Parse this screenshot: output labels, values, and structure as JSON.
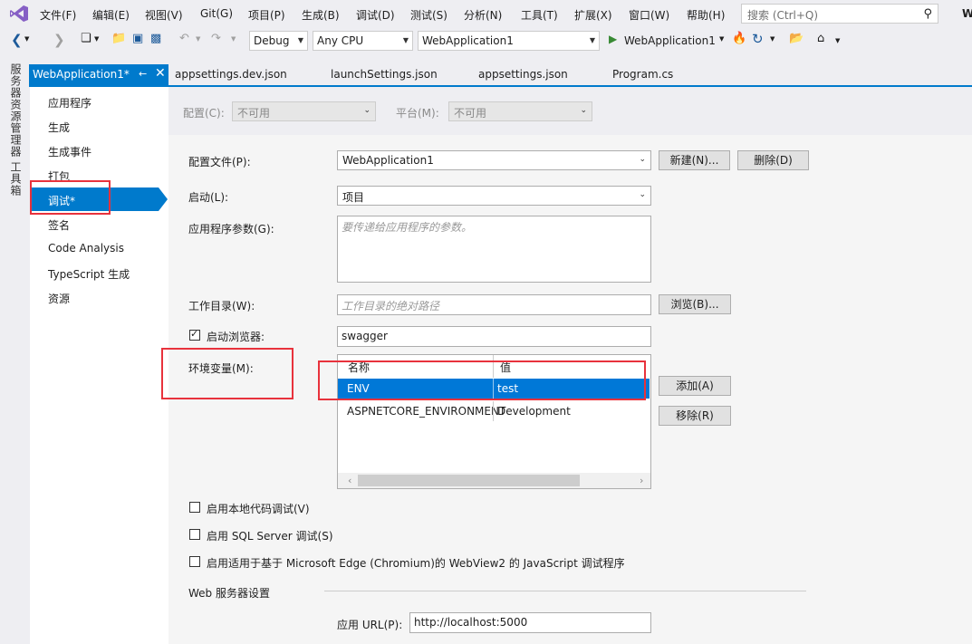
{
  "menu": [
    "文件(F)",
    "编辑(E)",
    "视图(V)",
    "Git(G)",
    "项目(P)",
    "生成(B)",
    "调试(D)",
    "测试(S)",
    "分析(N)",
    "工具(T)",
    "扩展(X)",
    "窗口(W)",
    "帮助(H)"
  ],
  "search": {
    "placeholder": "搜索 (Ctrl+Q)"
  },
  "title_fragment": "W",
  "toolbar": {
    "config": "Debug",
    "platform": "Any CPU",
    "project": "WebApplication1",
    "run_label": "WebApplication1"
  },
  "left_strip": {
    "server_explorer": "服务器资源管理器",
    "toolbox": "工具箱"
  },
  "tabs": {
    "active": "WebApplication1*",
    "others": [
      "appsettings.dev.json",
      "launchSettings.json",
      "appsettings.json",
      "Program.cs"
    ]
  },
  "nav": [
    "应用程序",
    "生成",
    "生成事件",
    "打包",
    "调试*",
    "签名",
    "Code Analysis",
    "TypeScript 生成",
    "资源"
  ],
  "top_row": {
    "config_label": "配置(C):",
    "config_value": "不可用",
    "platform_label": "平台(M):",
    "platform_value": "不可用"
  },
  "form": {
    "profile_label": "配置文件(P):",
    "profile_value": "WebApplication1",
    "new_button": "新建(N)...",
    "delete_button": "删除(D)",
    "launch_label": "启动(L):",
    "launch_value": "项目",
    "args_label": "应用程序参数(G):",
    "args_placeholder": "要传递给应用程序的参数。",
    "workdir_label": "工作目录(W):",
    "workdir_placeholder": "工作目录的绝对路径",
    "browse_button": "浏览(B)...",
    "launch_browser_label": "启动浏览器:",
    "launch_browser_value": "swagger",
    "env_label": "环境变量(M):",
    "env_headers": {
      "name": "名称",
      "value": "值"
    },
    "env_rows": [
      {
        "name": "ENV",
        "value": "test"
      },
      {
        "name": "ASPNETCORE_ENVIRONMENT",
        "value": "Development"
      }
    ],
    "add_button": "添加(A)",
    "remove_button": "移除(R)",
    "native_debug": "启用本地代码调试(V)",
    "sql_debug": "启用 SQL Server 调试(S)",
    "webview_debug": "启用适用于基于 Microsoft Edge (Chromium)的 WebView2 的 JavaScript 调试程序",
    "web_server_section": "Web 服务器设置",
    "app_url_label": "应用 URL(P):",
    "app_url_value": "http://localhost:5000"
  },
  "accent_color": "#007acc",
  "highlight_color": "#e8323c"
}
